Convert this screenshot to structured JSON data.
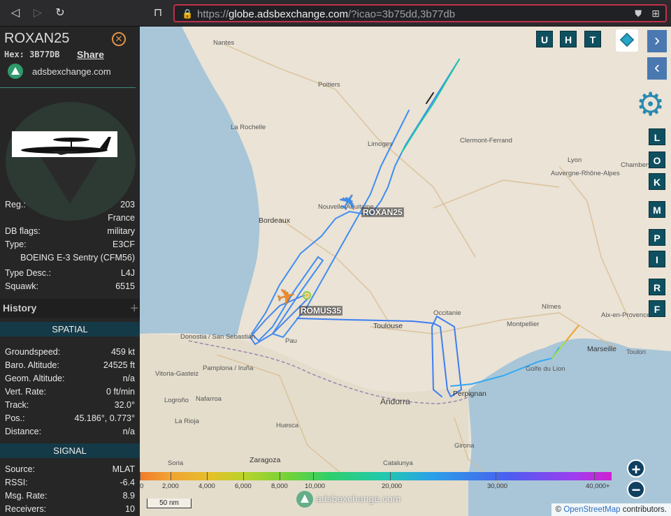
{
  "browser": {
    "url_prefix": "https://",
    "url_host": "globe.adsbexchange.com",
    "url_path": "/?icao=3b75dd,3b77db"
  },
  "sidebar": {
    "callsign": "ROXAN25",
    "hex_label": "Hex:",
    "hex_value": "3B77DB",
    "share_label": "Share",
    "brand": "adsbexchange.com",
    "details": [
      {
        "key": "Reg.:",
        "value": "203"
      },
      {
        "key": "",
        "value": "France"
      },
      {
        "key": "DB flags:",
        "value": "military"
      },
      {
        "key": "Type:",
        "value": "E3CF"
      },
      {
        "key": "",
        "value": "BOEING E-3 Sentry (CFM56)"
      },
      {
        "key": "Type Desc.:",
        "value": "L4J"
      },
      {
        "key": "Squawk:",
        "value": "6515"
      }
    ],
    "history_label": "History",
    "spatial_label": "SPATIAL",
    "spatial": [
      {
        "key": "Groundspeed:",
        "value": "459 kt"
      },
      {
        "key": "Baro. Altitude:",
        "value": "24525 ft"
      },
      {
        "key": "Geom. Altitude:",
        "value": "n/a"
      },
      {
        "key": "Vert. Rate:",
        "value": "0 ft/min"
      },
      {
        "key": "Track:",
        "value": "32.0°"
      },
      {
        "key": "Pos.:",
        "value": "45.186°, 0.773°"
      },
      {
        "key": "Distance:",
        "value": "n/a"
      }
    ],
    "signal_label": "SIGNAL",
    "signal": [
      {
        "key": "Source:",
        "value": "MLAT"
      },
      {
        "key": "RSSI:",
        "value": "-6.4"
      },
      {
        "key": "Msg. Rate:",
        "value": "8.9"
      },
      {
        "key": "Receivers:",
        "value": "10"
      }
    ]
  },
  "map": {
    "aircraft": [
      {
        "callsign": "ROXAN25",
        "color": "#3b8ff0"
      },
      {
        "callsign": "ROMUS35",
        "color": "#f08a24"
      }
    ],
    "top_buttons": [
      "U",
      "H",
      "T"
    ],
    "side_buttons": [
      "L",
      "O",
      "K",
      "M",
      "P",
      "I",
      "R",
      "F"
    ],
    "cities": [
      {
        "name": "Nantes"
      },
      {
        "name": "Poitiers"
      },
      {
        "name": "La Rochelle"
      },
      {
        "name": "Limoges"
      },
      {
        "name": "Clermont-Ferrand"
      },
      {
        "name": "Lyon"
      },
      {
        "name": "Auvergne-Rhône-Alpes"
      },
      {
        "name": "Chambery"
      },
      {
        "name": "Bordeaux"
      },
      {
        "name": "Nouvelle-Aquitaine"
      },
      {
        "name": "Donostia / San Sebastián"
      },
      {
        "name": "Pau"
      },
      {
        "name": "Toulouse"
      },
      {
        "name": "Occitanie"
      },
      {
        "name": "Montpellier"
      },
      {
        "name": "Nîmes"
      },
      {
        "name": "Aix-en-Provence"
      },
      {
        "name": "Marseille"
      },
      {
        "name": "Toulon"
      },
      {
        "name": "Pamplona / Iruña"
      },
      {
        "name": "Vitoria-Gasteiz"
      },
      {
        "name": "Nafarroa"
      },
      {
        "name": "Logroño"
      },
      {
        "name": "La Rioja"
      },
      {
        "name": "Andorra"
      },
      {
        "name": "Perpignan"
      },
      {
        "name": "Golfe du Lion"
      },
      {
        "name": "Huesca"
      },
      {
        "name": "Zaragoza"
      },
      {
        "name": "Girona"
      },
      {
        "name": "Soria"
      },
      {
        "name": "Catalunya"
      }
    ],
    "altitude_scale": [
      "0",
      "2,000",
      "4,000",
      "6,000",
      "8,000",
      "10,000",
      "20,000",
      "30,000",
      "40,000+"
    ],
    "scale_bar": "50 nm",
    "watermark": "adsbexchange.com",
    "attribution_prefix": "©",
    "attribution_link": "OpenStreetMap",
    "attribution_suffix": "contributors.",
    "zoom_in": "+",
    "zoom_out": "−"
  }
}
